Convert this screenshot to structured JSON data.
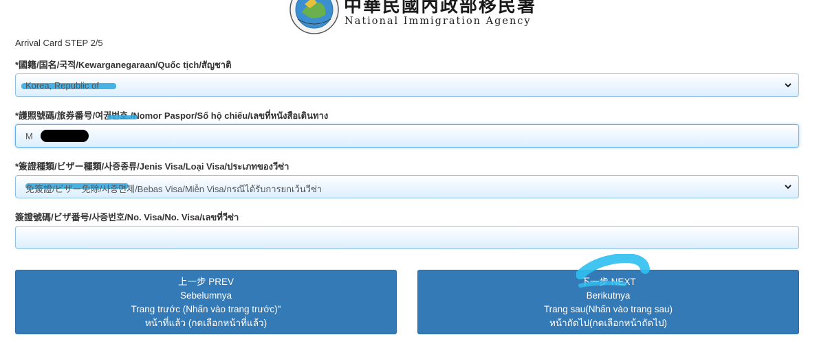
{
  "header": {
    "agency_name_cn": "中華民國內政部移民署",
    "agency_name_en": "National Immigration Agency",
    "logo_text": "National Immigration Agency"
  },
  "form": {
    "step": "Arrival Card STEP 2/5",
    "nationality": {
      "label": "*國籍/国名/국적/Kewarganegaraan/Quốc tịch/สัญชาติ",
      "value": "Korea, Republic of"
    },
    "passport": {
      "label": "*護照號碼/旅券番号/여권번호./Nomor Paspor/Số hộ chiếu/เลขที่หนังสือเดินทาง",
      "value_visible": "M"
    },
    "visa_type": {
      "label": "*簽證種類/ビザー種類/사증종류/Jenis Visa/Loại Visa/ประเภทของวีซ่า",
      "value": "免簽證/ビザー免除/사증면제/Bebas Visa/Miễn Visa/กรณีได้รับการยกเว้นวีซ่า"
    },
    "visa_number": {
      "label": "簽證號碼/ビザ番号/사증번호/No. Visa/No. Visa/เลขที่วีซ่า",
      "value": ""
    }
  },
  "buttons": {
    "prev": {
      "lines": [
        "上一步 PREV",
        "Sebelumnya",
        "Trang trước (Nhấn vào trang trước)\"",
        "หน้าที่แล้ว (กดเลือกหน้าที่แล้ว)"
      ]
    },
    "next": {
      "lines": [
        "下一步 NEXT",
        "Berikutnya",
        "Trang sau(Nhấn vào trang sau)",
        "หน้าถัดไป(กดเลือกหน้าถัดไป)"
      ]
    }
  },
  "colors": {
    "button": "#337ab7",
    "field_border": "#8fc0e3",
    "highlight": "#2aa6df"
  }
}
